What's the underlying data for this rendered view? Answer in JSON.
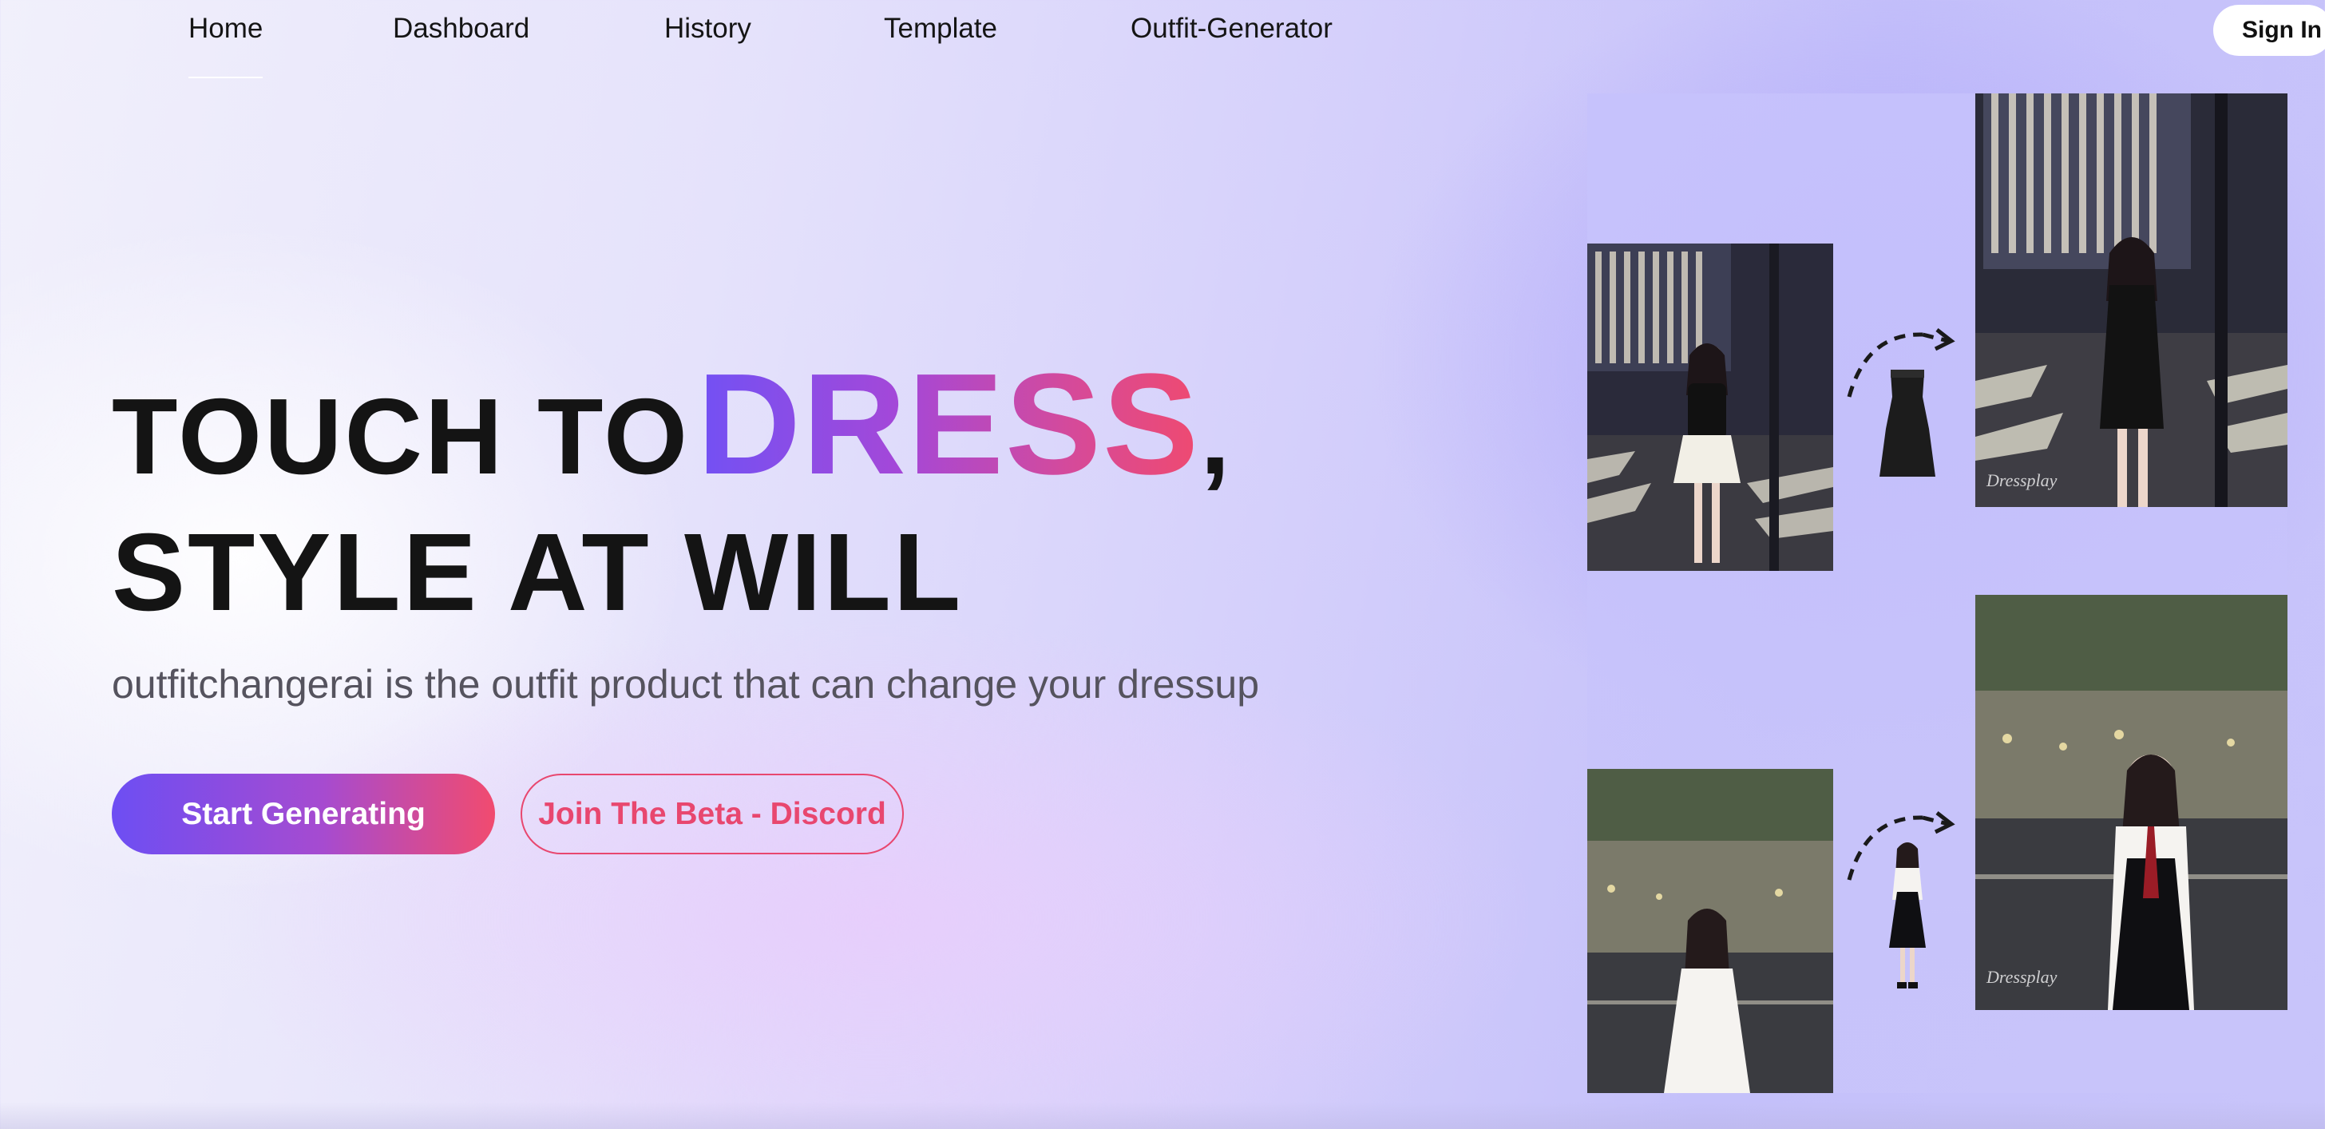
{
  "nav": {
    "items": [
      {
        "label": "Home",
        "active": true
      },
      {
        "label": "Dashboard",
        "active": false
      },
      {
        "label": "History",
        "active": false
      },
      {
        "label": "Template",
        "active": false
      },
      {
        "label": "Outfit-Generator",
        "active": false
      }
    ],
    "signin_label": "Sign In"
  },
  "hero": {
    "line1_prefix": "TOUCH TO",
    "line1_highlight": "DRESS",
    "line1_suffix": ",",
    "line2": "STYLE AT WILL",
    "subtitle": "outfitchangerai is the outfit product that can change your dressup"
  },
  "actions": {
    "primary_label": "Start Generating",
    "secondary_label": "Join The Beta - Discord"
  },
  "showcase": {
    "watermark": "Dressplay"
  },
  "colors": {
    "gradient_start": "#7251f4",
    "gradient_end": "#ef4a70",
    "accent_pink": "#e8476f"
  }
}
